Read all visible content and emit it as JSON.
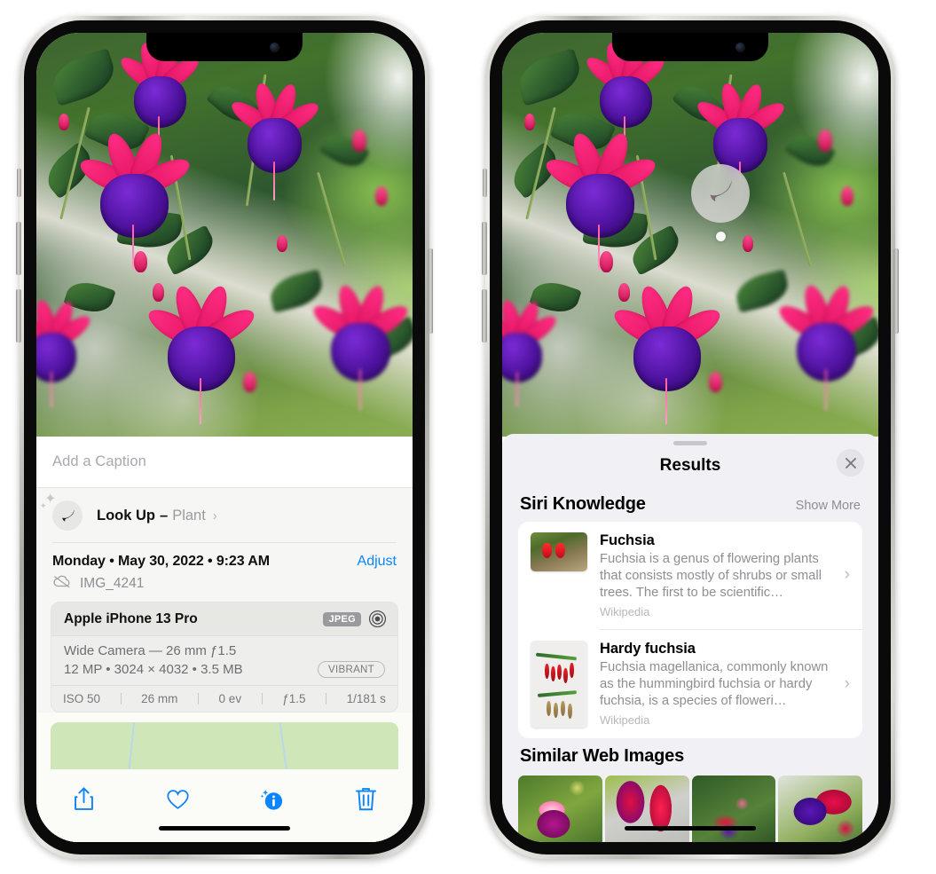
{
  "left_phone": {
    "photo": {
      "alt_desc": "fuchsia-flowers-photo"
    },
    "caption": {
      "placeholder": "Add a Caption",
      "value": ""
    },
    "lookup_row": {
      "icon": "leaf-icon",
      "label": "Look Up",
      "dash": "–",
      "subject": "Plant",
      "chevron": "›"
    },
    "date_row": {
      "date_text": "Monday • May 30, 2022 • 9:23 AM",
      "adjust_label": "Adjust"
    },
    "file_row": {
      "icon": "icloud-slash-icon",
      "filename": "IMG_4241"
    },
    "exif": {
      "device": "Apple iPhone 13 Pro",
      "format_badge": "JPEG",
      "aperture_icon": "aperture-icon",
      "lens_line": "Wide Camera — 26 mm ƒ1.5",
      "spec_line": "12 MP • 3024 × 4032 • 3.5 MB",
      "style_badge": "VIBRANT",
      "stats": [
        "ISO 50",
        "26 mm",
        "0 ev",
        "ƒ1.5",
        "1/181 s"
      ]
    },
    "toolbar": [
      {
        "name": "share-button",
        "icon": "share-icon"
      },
      {
        "name": "favorite-button",
        "icon": "heart-icon"
      },
      {
        "name": "info-button",
        "icon": "info-sparkle-icon"
      },
      {
        "name": "delete-button",
        "icon": "trash-icon"
      }
    ],
    "map": {
      "pin": "photo-pin-thumbnail"
    }
  },
  "right_phone": {
    "photo": {
      "alt_desc": "fuchsia-flowers-photo"
    },
    "visual_lookup_badge": {
      "icon": "leaf-icon"
    },
    "sheet": {
      "title": "Results",
      "close_icon": "close-icon",
      "siri_knowledge": {
        "heading": "Siri Knowledge",
        "action": "Show More",
        "items": [
          {
            "title": "Fuchsia",
            "description": "Fuchsia is a genus of flowering plants that consists mostly of shrubs or small trees. The first to be scientific…",
            "source": "Wikipedia",
            "chevron": "›",
            "thumb": "fuchsia-red-flowers-thumb"
          },
          {
            "title": "Hardy fuchsia",
            "description": "Fuchsia magellanica, commonly known as the hummingbird fuchsia or hardy fuchsia, is a species of floweri…",
            "source": "Wikipedia",
            "chevron": "›",
            "thumb": "hardy-fuchsia-specimen-thumb"
          }
        ]
      },
      "similar_web_images": {
        "heading": "Similar Web Images",
        "thumbs": [
          "web-image-1-magenta-fuchsia",
          "web-image-2-red-fuchsia-closeup",
          "web-image-3-fuchsia-bush",
          "web-image-4-purple-red-fuchsia"
        ]
      }
    }
  },
  "colors": {
    "accent_blue": "#0a84ff",
    "sheet_bg": "#f1f1f5",
    "info_bg": "#fbfbf7",
    "muted_text": "#8e8e93"
  }
}
